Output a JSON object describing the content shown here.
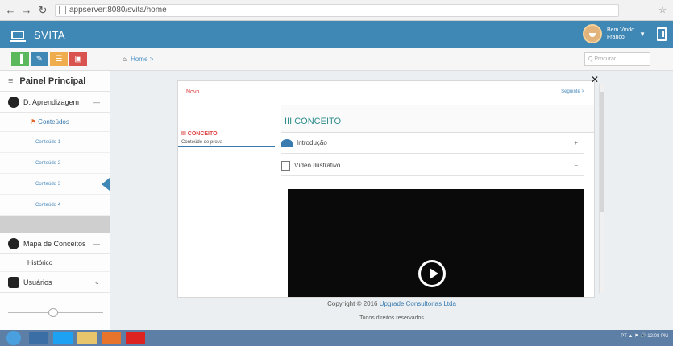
{
  "browser": {
    "url": "appserver:8080/svita/home"
  },
  "header": {
    "app_name": "SVITA",
    "welcome_line1": "Bem Vindo",
    "welcome_line2": "Franco",
    "caret": "▼"
  },
  "toolbar": {
    "buttons": [
      {
        "label": "▐",
        "color": "#5cb85c"
      },
      {
        "label": "✎",
        "color": "#3f87b4"
      },
      {
        "label": "☰",
        "color": "#f0ad4e"
      },
      {
        "label": "▣",
        "color": "#d9534f"
      }
    ],
    "breadcrumb_home": "Home",
    "breadcrumb_sep": ">",
    "search_placeholder": "Q Procurar"
  },
  "sidebar": {
    "title": "Painel Principal",
    "section1": "D. Aprendizagem",
    "section1_toggle": "—",
    "submenu": "Conteúdos",
    "items": [
      "Conteúdo 1",
      "Conteúdo 2",
      "Conteúdo 3",
      "Conteúdo 4"
    ],
    "section2": "Mapa de Conceitos",
    "section2_toggle": "—",
    "historico": "Histórico",
    "section3": "Usuários",
    "section3_toggle": "⌄"
  },
  "panel": {
    "prev": "Novo",
    "next": "Seguinte >",
    "left_title": "III CONCEITO",
    "left_sub": "Conteúdo de prova",
    "heading": "III CONCEITO",
    "acc1": "Introdução",
    "acc1_toggle": "+",
    "acc2": "Vídeo Ilustrativo",
    "acc2_toggle": "−"
  },
  "footer": {
    "copyright_prefix": "Copyright © 2016",
    "company": "Upgrade Consultorias Ltda",
    "rights": "Todos direitos reservados"
  },
  "taskbar": {
    "tray": "PT  ▲ ⚑ 🔊  12:08 PM"
  }
}
